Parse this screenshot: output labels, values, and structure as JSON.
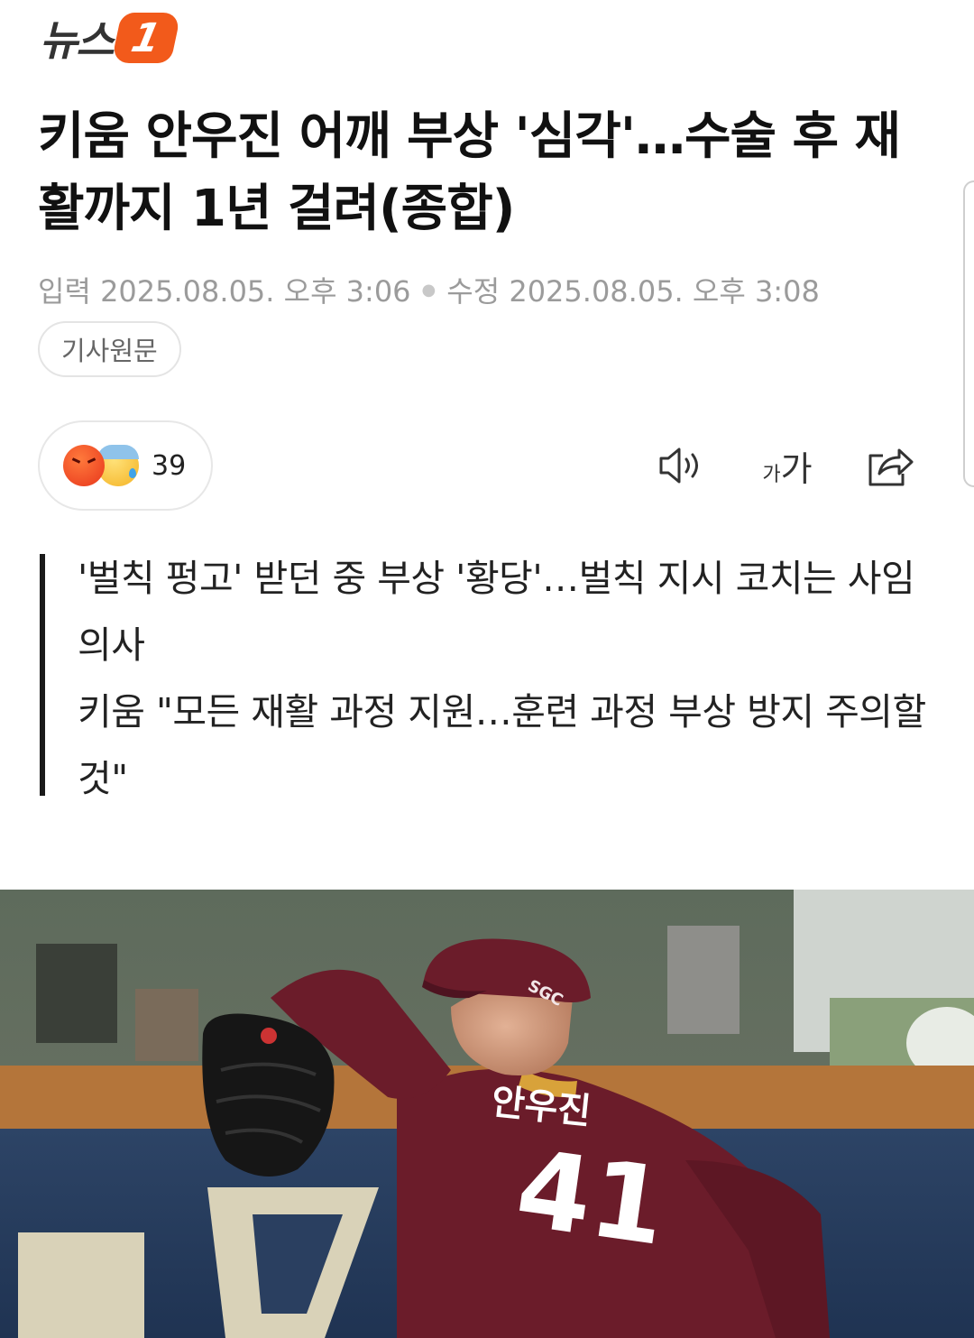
{
  "header": {
    "logo_text": "뉴스",
    "logo_badge": "1"
  },
  "article": {
    "title": "키움 안우진 어깨 부상 '심각'…수술 후 재활까지 1년 걸려(종합)",
    "input_label": "입력",
    "input_datetime": "2025.08.05. 오후 3:06",
    "edit_label": "수정",
    "edit_datetime": "2025.08.05. 오후 3:08",
    "source_button": "기사원문",
    "reactions": {
      "count": "39",
      "icons": [
        "angry-face-icon",
        "sad-sweat-face-icon"
      ]
    },
    "toolbar": {
      "font_small": "가",
      "font_large": "가",
      "icons": [
        "speaker-icon",
        "font-size-icon",
        "share-icon"
      ]
    },
    "summary": [
      "'벌칙 펑고' 받던 중 부상 '황당'…벌칙 지시 코치는 사임 의사",
      "키움 \"모든 재활 과정 지원…훈련 과정 부상 방지 주의할 것\""
    ],
    "photo": {
      "jersey_name": "안우진",
      "jersey_number": "41",
      "cap_logo": "SGC"
    }
  },
  "colors": {
    "brand": "#f25a1b",
    "meta": "#9b9b9b",
    "jersey": "#6b1c2a"
  }
}
